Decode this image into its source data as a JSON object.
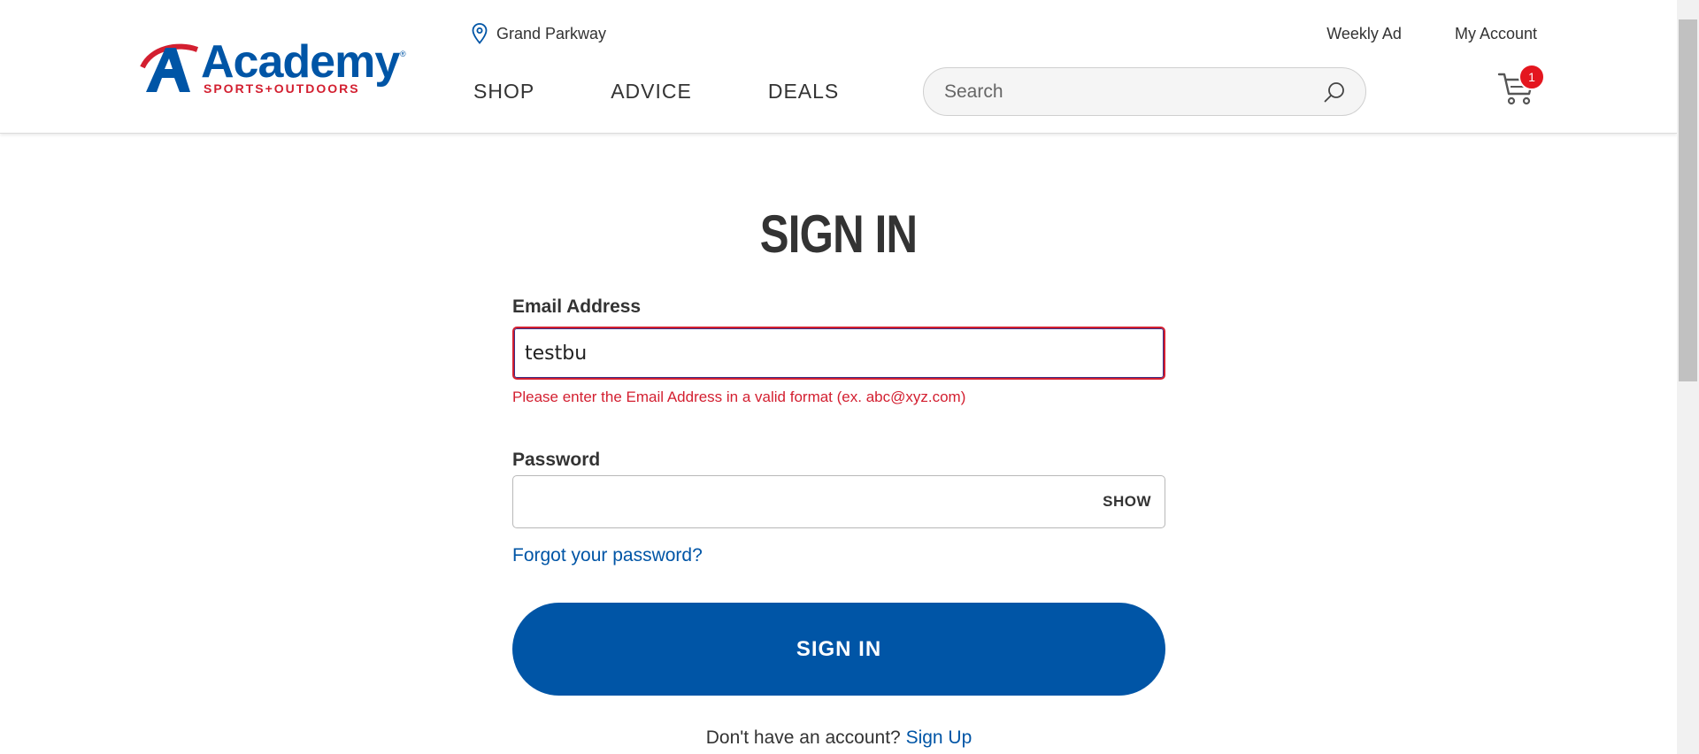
{
  "header": {
    "logo": {
      "word": "Academy",
      "registered": "®",
      "subtitle": "SPORTS+OUTDOORS"
    },
    "store_name": "Grand Parkway",
    "top_links": [
      "Weekly Ad",
      "My Account"
    ],
    "nav": [
      "SHOP",
      "ADVICE",
      "DEALS"
    ],
    "search": {
      "placeholder": "Search",
      "value": ""
    },
    "cart": {
      "count": "1"
    }
  },
  "main": {
    "title": "SIGN IN",
    "email": {
      "label": "Email Address",
      "value": "testbu",
      "error": "Please enter the Email Address in a valid format (ex. abc@xyz.com)"
    },
    "password": {
      "label": "Password",
      "value": "",
      "show_label": "SHOW"
    },
    "forgot_link": "Forgot your password?",
    "signin_button": "SIGN IN",
    "account_prompt": "Don't have an account? ",
    "signup_link": "Sign Up"
  },
  "colors": {
    "brand_blue": "#0055a6",
    "brand_red": "#d31f30",
    "badge_red": "#e4161f"
  }
}
